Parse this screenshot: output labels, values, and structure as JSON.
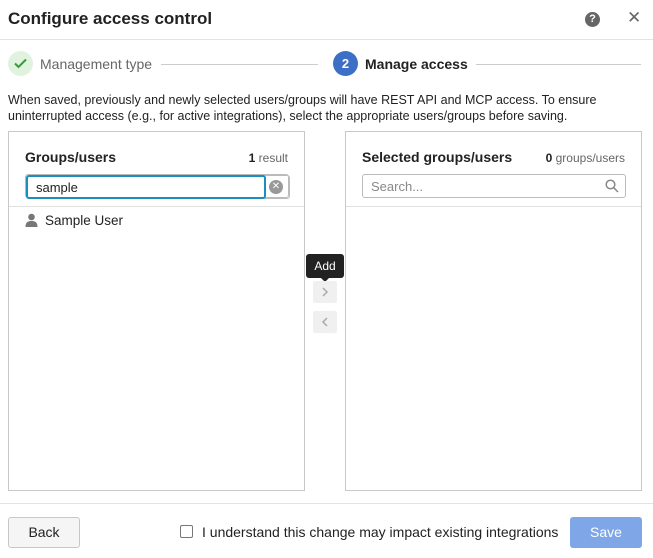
{
  "dialog": {
    "title": "Configure access control",
    "help_icon": "?",
    "close_icon": "✕"
  },
  "steps": [
    {
      "label": "Management type",
      "status": "completed",
      "icon": "check-icon"
    },
    {
      "number": "2",
      "label": "Manage access",
      "status": "active"
    }
  ],
  "description": "When saved, previously and newly selected users/groups will have REST API and MCP access. To ensure uninterrupted access (e.g., for active integrations), select the appropriate users/groups before saving.",
  "left_panel": {
    "title": "Groups/users",
    "count_number": "1",
    "count_label": "result",
    "search_value": "sample",
    "results": [
      {
        "label": "Sample User",
        "icon": "user-icon"
      }
    ]
  },
  "right_panel": {
    "title": "Selected groups/users",
    "count_number": "0",
    "count_label": "groups/users",
    "search_placeholder": "Search..."
  },
  "transfer": {
    "tooltip": "Add",
    "add_icon": "chevron-right-icon",
    "remove_icon": "chevron-left-icon"
  },
  "footer": {
    "back_label": "Back",
    "acknowledge_label": "I understand this change may impact existing integrations",
    "acknowledge_checked": false,
    "save_label": "Save"
  },
  "colors": {
    "accent": "#3d6fc7",
    "save_disabled": "#7fa6e6",
    "focus_border": "#1a8fbf",
    "completed_bg": "#dff3df",
    "completed_check": "#3a9a3a"
  }
}
